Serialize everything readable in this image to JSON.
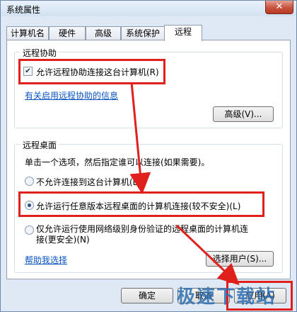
{
  "window": {
    "title": "系统属性",
    "close_icon": "close-icon"
  },
  "tabs": [
    "计算机名",
    "硬件",
    "高级",
    "系统保护",
    "远程"
  ],
  "remote_assistance": {
    "legend": "远程协助",
    "checkbox_label": "允许远程协助连接这台计算机(R)",
    "checked": true,
    "info_link": "有关启用远程协助的信息",
    "advanced_button": "高级(V)..."
  },
  "remote_desktop": {
    "legend": "远程桌面",
    "description": "单击一个选项，然后指定谁可以连接(如果需要)。",
    "options": [
      "不允许连接到这台计算机(D)",
      "允许运行任意版本远程桌面的计算机连接(较不安全)(L)",
      "仅允许运行使用网络级别身份验证的远程桌面的计算机连接(更安全)(N)"
    ],
    "selected_index": 1,
    "help_link": "帮助我选择",
    "select_users_button": "选择用户(S)..."
  },
  "footer": {
    "ok": "确定",
    "cancel": "取消",
    "apply": "应用(A)"
  },
  "watermark": "极速下载站",
  "colors": {
    "highlight": "#e0201c",
    "link": "#0a55c4"
  }
}
